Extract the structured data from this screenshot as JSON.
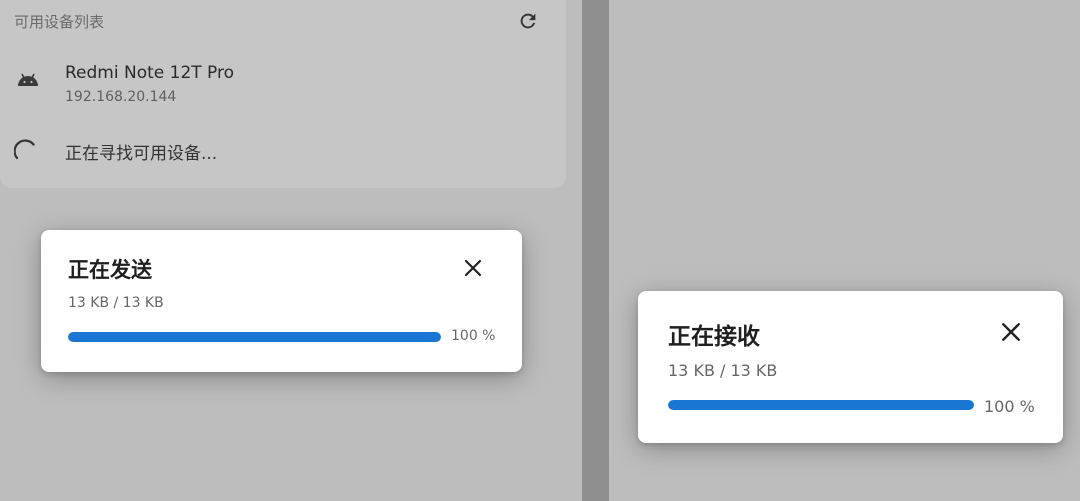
{
  "device_list": {
    "title": "可用设备列表",
    "refresh_icon": "refresh-icon",
    "devices": [
      {
        "name": "Redmi Note 12T Pro",
        "ip": "192.168.20.144",
        "icon": "android-icon"
      }
    ],
    "searching_text": "正在寻找可用设备..."
  },
  "send_dialog": {
    "title": "正在发送",
    "size_text": "13 KB / 13 KB",
    "progress": 1.0,
    "percent_text": "100 %"
  },
  "receive_dialog": {
    "title": "正在接收",
    "size_text": "13 KB / 13 KB",
    "progress": 1.0,
    "percent_text": "100 %"
  },
  "colors": {
    "accent": "#1976d2",
    "overlay": "#bdbdbd",
    "divider": "#8f8f8f"
  }
}
